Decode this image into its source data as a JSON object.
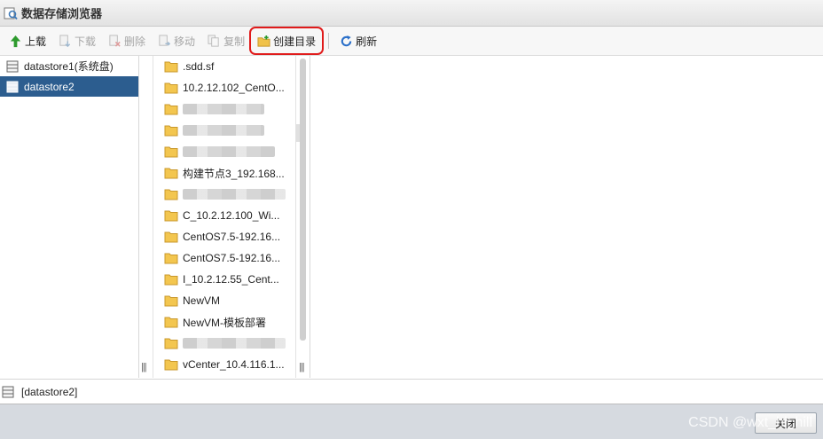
{
  "window": {
    "title": "数据存储浏览器"
  },
  "toolbar": [
    {
      "label": "上载",
      "icon": "upload-icon",
      "enabled": true
    },
    {
      "label": "下载",
      "icon": "download-icon",
      "enabled": false
    },
    {
      "label": "删除",
      "icon": "delete-icon",
      "enabled": false
    },
    {
      "label": "移动",
      "icon": "move-icon",
      "enabled": false
    },
    {
      "label": "复制",
      "icon": "copy-icon",
      "enabled": false
    },
    {
      "label": "创建目录",
      "icon": "new-folder-icon",
      "enabled": true,
      "highlighted": true
    },
    {
      "label": "刷新",
      "icon": "refresh-icon",
      "enabled": true
    }
  ],
  "datastores": [
    {
      "label": "datastore1(系统盘)",
      "selected": false
    },
    {
      "label": "datastore2",
      "selected": true
    }
  ],
  "folders": [
    ".sdd.sf",
    "10.2.12.102_CentO...",
    "",
    "",
    "",
    "构建节点3_192.168...",
    "",
    "C_10.2.12.100_Wi...",
    "CentOS7.5-192.16...",
    "CentOS7.5-192.16...",
    "I_10.2.12.55_Cent...",
    "NewVM",
    "NewVM-模板部署",
    "",
    "vCenter_10.4.116.1..."
  ],
  "grip_glyph": "|||",
  "status": {
    "path": "[datastore2]"
  },
  "footer": {
    "close_label": "关闭",
    "watermark": "CSDN @wxt_hi_hill"
  },
  "colors": {
    "selection": "#2c5d8f",
    "highlight_box": "#e01b1b",
    "footer_bg": "#d6dae0"
  }
}
